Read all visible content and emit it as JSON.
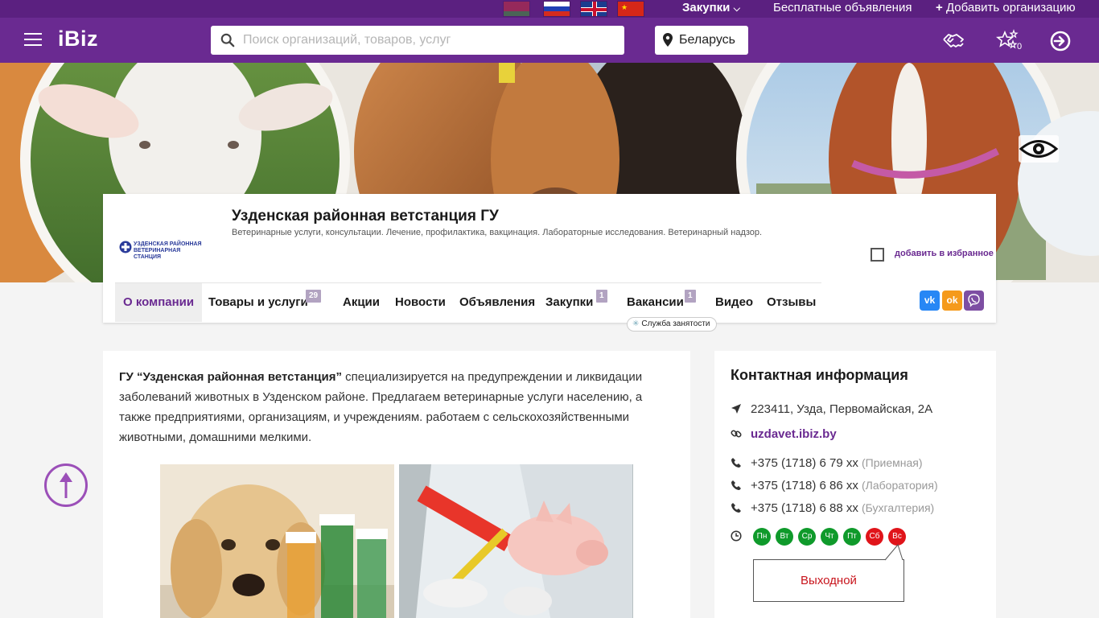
{
  "topbar": {
    "purchases": "Закупки",
    "free_ads": "Бесплатные объявления",
    "add_org": "Добавить организацию"
  },
  "header": {
    "logo": "iBiz",
    "search_placeholder": "Поиск организаций, товаров, услуг",
    "region": "Беларусь",
    "favorites_count": "0"
  },
  "company": {
    "logo_line1": "УЗДЕНСКАЯ РАЙОННАЯ",
    "logo_line2": "ВЕТЕРИНАРНАЯ СТАНЦИЯ",
    "title": "Узденская районная ветстанция ГУ",
    "description": "Ветеринарные услуги, консультации. Лечение, профилактика, вакцинация. Лабораторные исследования. Ветеринарный надзор.",
    "add_favorite": "добавить в избранное"
  },
  "tabs": [
    {
      "label": "О компании"
    },
    {
      "label": "Товары и услуги",
      "badge": "29"
    },
    {
      "label": "Акции"
    },
    {
      "label": "Новости"
    },
    {
      "label": "Объявления"
    },
    {
      "label": "Закупки",
      "badge": "1"
    },
    {
      "label": "Вакансии",
      "badge": "1"
    },
    {
      "label": "Видео"
    },
    {
      "label": "Отзывы"
    }
  ],
  "employment_tooltip": "Служба занятости",
  "social": {
    "vk": "vk",
    "ok": "ok",
    "viber": "viber"
  },
  "about": {
    "lead": "ГУ “Узденская районная ветстанция”",
    "text": " специализируется на предупреждении и ликвидации заболеваний животных в Узденском районе. Предлагаем ветеринарные услуги населению, а также предприятиями, организациям, и учреждениям. работаем с сельскохозяйственными животными, домашними мелкими."
  },
  "contacts": {
    "title": "Контактная информация",
    "address": "223411, Узда, Первомайская, 2А",
    "site": "uzdavet.ibiz.by",
    "phones": [
      {
        "number": "+375 (1718) 6 79 xx",
        "note": "(Приемная)"
      },
      {
        "number": "+375 (1718) 6 86 xx",
        "note": "(Лаборатория)"
      },
      {
        "number": "+375 (1718) 6 88 xx",
        "note": "(Бухгалтерия)"
      }
    ],
    "days": [
      {
        "label": "Пн",
        "status": "work"
      },
      {
        "label": "Вт",
        "status": "work"
      },
      {
        "label": "Ср",
        "status": "work"
      },
      {
        "label": "Чт",
        "status": "work"
      },
      {
        "label": "Пт",
        "status": "work"
      },
      {
        "label": "Сб",
        "status": "off"
      },
      {
        "label": "Вс",
        "status": "off"
      }
    ],
    "day_off": "Выходной"
  },
  "colors": {
    "brand": "#6a2a91",
    "workday": "#0f9a2b",
    "dayoff": "#e0141a"
  }
}
